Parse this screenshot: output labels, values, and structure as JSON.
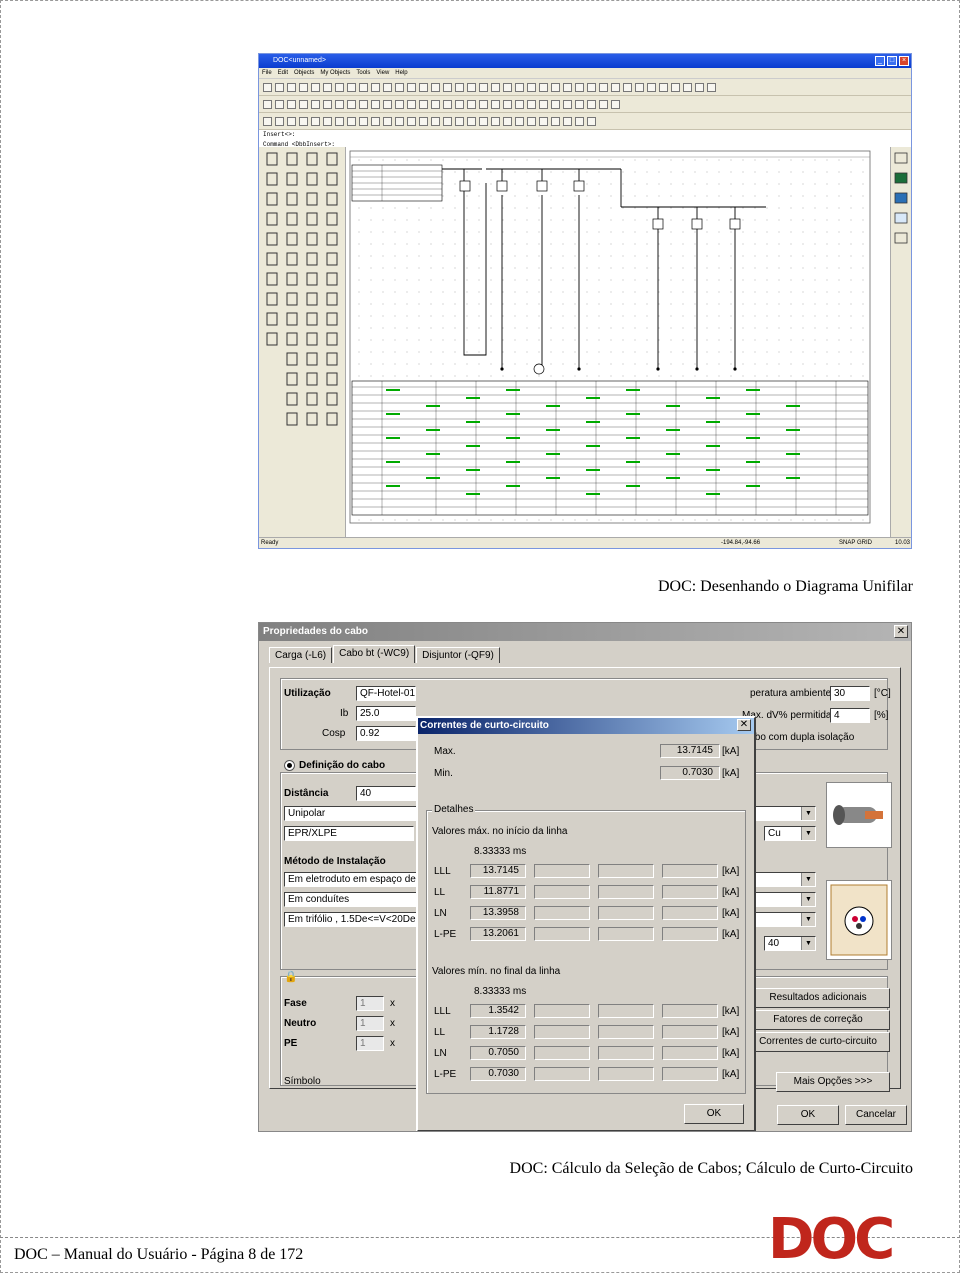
{
  "cad_window": {
    "title": "DOC<unnamed>",
    "menu": [
      "File",
      "Edit",
      "Objects",
      "My Objects",
      "Tools",
      "View",
      "Help"
    ],
    "cmd_line1": "Insert<>:",
    "cmd_line2": "Command <DbbInsert>:",
    "status_left": "Ready",
    "status_coords": "-194.84,-94.66",
    "status_snap": "SNAP",
    "status_grid": "GRID",
    "status_zoom": "10.03",
    "colors": {
      "titlebar": "#0a3ccf",
      "drawing_lines": "#000000",
      "table_text": "#00aa00"
    }
  },
  "caption1": "DOC: Desenhando o Diagrama Unifilar",
  "cable_dialog": {
    "title": "Propriedades do cabo",
    "tabs": [
      "Carga (-L6)",
      "Cabo bt (-WC9)",
      "Disjuntor (-QF9)"
    ],
    "utilizacao_label": "Utilização",
    "utilizacao_value": "QF-Hotel-01",
    "ib_label": "Ib",
    "ib_value": "25.0",
    "cosp_label": "Cosp",
    "cosp_value": "0.92",
    "temp_label": "peratura ambiente",
    "temp_value": "30",
    "temp_unit": "[°C]",
    "dv_label": "Max. dV% permitida",
    "dv_value": "4",
    "dv_unit": "[%]",
    "dupla_label": "Cabo com dupla isolação",
    "definicao_label": "Definição do cabo",
    "distancia_label": "Distância",
    "distancia_value": "40",
    "tipo_value": "Unipolar",
    "isolamento_value": "EPR/XLPE",
    "material_value": "Cu",
    "metodo_label": "Método de Instalação",
    "metodo1": "Em eletroduto em espaço de co",
    "metodo2": "Em conduítes",
    "metodo3": "Em trifólio , 1.5De<=V<20De",
    "metodo_extra": "40",
    "fase_label": "Fase",
    "neutro_label": "Neutro",
    "pe_label": "PE",
    "qty_value": "1",
    "times": "x",
    "simbolo_label": "Símbolo",
    "btn_resultados": "Resultados adicionais",
    "btn_fatores": "Fatores de correção",
    "btn_correntes": "Correntes de curto-circuito",
    "btn_mais": "Mais Opções >>>",
    "btn_ok": "OK",
    "btn_cancel": "Cancelar"
  },
  "sc_dialog": {
    "title": "Correntes de curto-circuito",
    "max_label": "Max.",
    "max_value": "13.7145",
    "min_label": "Min.",
    "min_value": "0.7030",
    "unit": "[kA]",
    "detalhes_label": "Detalhes",
    "max_section": "Valores máx. no início da linha",
    "max_time": "8.33333 ms",
    "max_rows": [
      {
        "label": "LLL",
        "value": "13.7145"
      },
      {
        "label": "LL",
        "value": "11.8771"
      },
      {
        "label": "LN",
        "value": "13.3958"
      },
      {
        "label": "L-PE",
        "value": "13.2061"
      }
    ],
    "min_section": "Valores mín. no final da linha",
    "min_time": "8.33333 ms",
    "min_rows": [
      {
        "label": "LLL",
        "value": "1.3542"
      },
      {
        "label": "LL",
        "value": "1.1728"
      },
      {
        "label": "LN",
        "value": "0.7050"
      },
      {
        "label": "L-PE",
        "value": "0.7030"
      }
    ],
    "ok": "OK"
  },
  "caption2": "DOC: Cálculo da Seleção de Cabos; Cálculo de Curto-Circuito",
  "footer": "DOC – Manual do Usuário - Página 8 de 172",
  "logo_text": "DOC"
}
